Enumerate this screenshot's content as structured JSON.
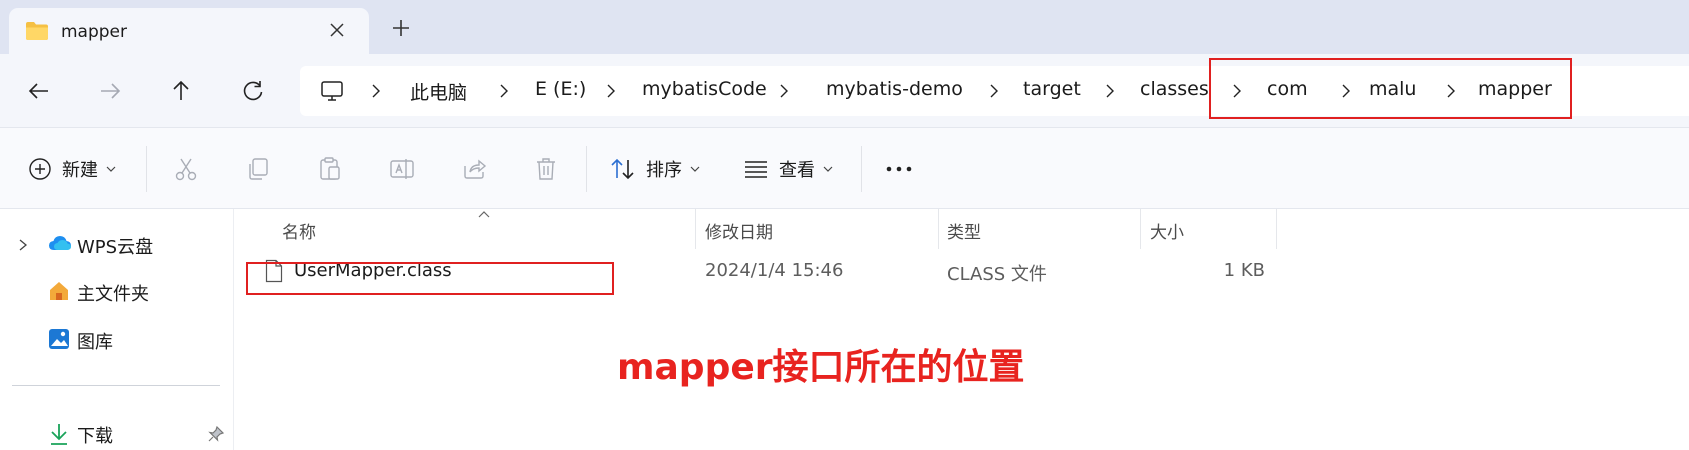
{
  "tab": {
    "title": "mapper",
    "icon": "folder-icon"
  },
  "nav": {
    "back": "back-arrow-icon",
    "forward": "forward-arrow-icon",
    "up": "up-arrow-icon",
    "refresh": "refresh-icon"
  },
  "breadcrumb": {
    "root_icon": "monitor-icon",
    "items": [
      "此电脑",
      "E (E:)",
      "mybatisCode",
      "mybatis-demo",
      "target",
      "classes",
      "com",
      "malu",
      "mapper"
    ]
  },
  "commands": {
    "new": "新建",
    "sort": "排序",
    "view": "查看",
    "more": "..."
  },
  "sidebar": {
    "items": [
      {
        "label": "WPS云盘",
        "icon": "cloud-icon"
      },
      {
        "label": "主文件夹",
        "icon": "home-icon"
      },
      {
        "label": "图库",
        "icon": "gallery-icon"
      },
      {
        "label": "下载",
        "icon": "download-icon"
      }
    ]
  },
  "columns": {
    "name": "名称",
    "date": "修改日期",
    "type": "类型",
    "size": "大小"
  },
  "files": [
    {
      "name": "UserMapper.class",
      "date": "2024/1/4 15:46",
      "type": "CLASS 文件",
      "size": "1 KB"
    }
  ],
  "annotation": "mapper接口所在的位置",
  "colors": {
    "highlight": "#e02020",
    "annotation": "#e8231f",
    "tab_strip": "#dfe4f2"
  }
}
